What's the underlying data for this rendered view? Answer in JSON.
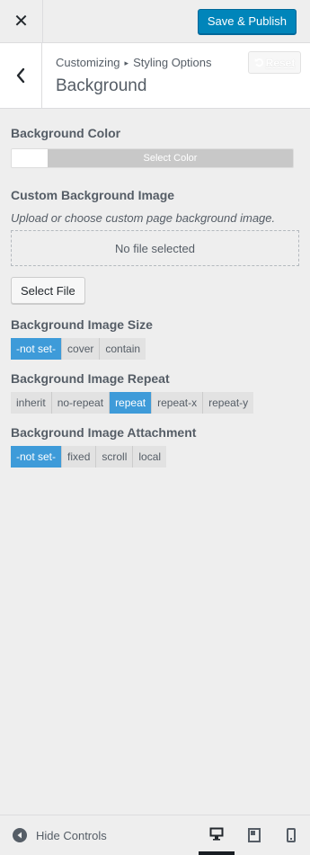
{
  "topbar": {
    "close_glyph": "✕",
    "publish_label": "Save & Publish"
  },
  "section": {
    "breadcrumb_root": "Customizing",
    "breadcrumb_sep": "▸",
    "breadcrumb_parent": "Styling Options",
    "title": "Background",
    "reset_label": "Reset"
  },
  "background_color": {
    "label": "Background Color",
    "select_label": "Select Color",
    "value": "#ffffff"
  },
  "background_image": {
    "label": "Custom Background Image",
    "description": "Upload or choose custom page background image.",
    "placeholder": "No file selected",
    "select_button": "Select File"
  },
  "image_size": {
    "label": "Background Image Size",
    "options": [
      "-not set-",
      "cover",
      "contain"
    ],
    "selected": "-not set-"
  },
  "image_repeat": {
    "label": "Background Image Repeat",
    "options": [
      "inherit",
      "no-repeat",
      "repeat",
      "repeat-x",
      "repeat-y"
    ],
    "selected": "repeat"
  },
  "image_attachment": {
    "label": "Background Image Attachment",
    "options": [
      "-not set-",
      "fixed",
      "scroll",
      "local"
    ],
    "selected": "-not set-"
  },
  "footer": {
    "hide_controls": "Hide Controls",
    "devices": [
      "desktop",
      "tablet",
      "mobile"
    ],
    "active_device": "desktop"
  },
  "colors": {
    "accent": "#0085ba",
    "selected_segment": "#3e9bd9"
  }
}
